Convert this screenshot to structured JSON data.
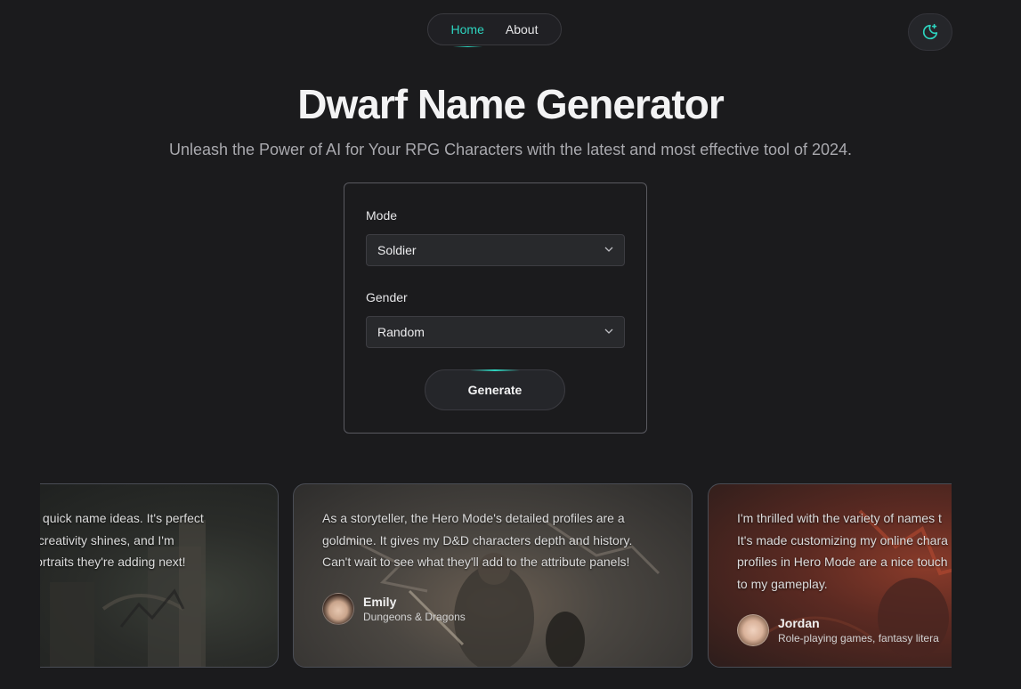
{
  "nav": {
    "home": "Home",
    "about": "About"
  },
  "theme_toggle": {
    "icon": "moon-sparkle-icon"
  },
  "hero": {
    "title": "Dwarf Name Generator",
    "subtitle": "Unleash the Power of AI for Your RPG Characters with the latest and most effective tool of 2024."
  },
  "form": {
    "mode_label": "Mode",
    "mode_value": "Soldier",
    "gender_label": "Gender",
    "gender_value": "Random",
    "generate_label": "Generate"
  },
  "testimonials": [
    {
      "lines": [
        "e for quick name ideas. It's perfect",
        "AI's creativity shines, and I'm",
        "er portraits they're adding next!"
      ]
    },
    {
      "lines": [
        "As a storyteller, the Hero Mode's detailed profiles are a",
        "goldmine. It gives my D&D characters depth and history.",
        "Can't wait to see what they'll add to the attribute panels!"
      ],
      "name": "Emily",
      "role": "Dungeons & Dragons"
    },
    {
      "lines": [
        "I'm thrilled with the variety of names t",
        "It's made customizing my online chara",
        "profiles in Hero Mode are a nice touch",
        "to my gameplay."
      ],
      "name": "Jordan",
      "role": "Role-playing games, fantasy litera"
    }
  ],
  "colors": {
    "accent": "#2dd4bf",
    "background": "#1b1b1d"
  }
}
